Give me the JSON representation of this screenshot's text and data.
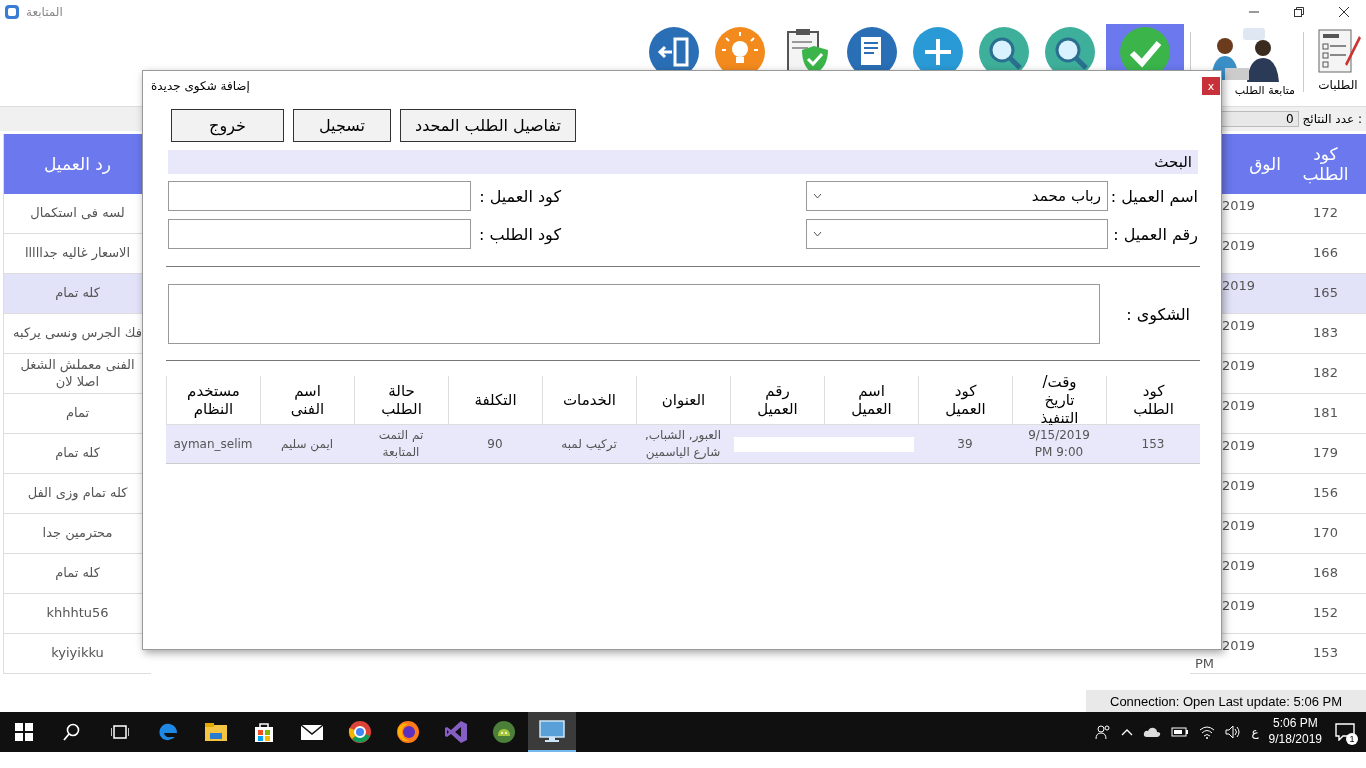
{
  "window": {
    "title": "المتابعة"
  },
  "toolbar": {
    "items": [
      {
        "kind": "orders",
        "label": "الطلبات",
        "selected": false
      },
      {
        "kind": "support",
        "label": "متابعة الطلب",
        "selected": false
      },
      {
        "kind": "check",
        "selected": true
      },
      {
        "kind": "search",
        "selected": false
      },
      {
        "kind": "search",
        "selected": false
      },
      {
        "kind": "add",
        "selected": false
      },
      {
        "kind": "document",
        "selected": false
      },
      {
        "kind": "clipboard",
        "selected": false
      },
      {
        "kind": "idea",
        "selected": false
      },
      {
        "kind": "exit",
        "selected": false
      }
    ]
  },
  "results": {
    "label": "عدد النتائج :",
    "value": "0"
  },
  "table": {
    "columns": [
      "كود الطلب",
      "الوق",
      "رد العميل"
    ],
    "rows": [
      {
        "code": "172",
        "time": "2019",
        "reply": "لسه فى استكمال",
        "selected": false
      },
      {
        "code": "166",
        "time": "2019",
        "reply": "الاسعار غاليه جدااااا",
        "selected": false
      },
      {
        "code": "165",
        "time": "2019",
        "reply": "كله تمام",
        "selected": true
      },
      {
        "code": "183",
        "time": "2019",
        "reply": "فك الجرس ونسى يركبه",
        "selected": false
      },
      {
        "code": "182",
        "time": "2019",
        "reply": "الفنى معملش الشغل اصلا لان",
        "selected": false
      },
      {
        "code": "181",
        "time": "2019",
        "reply": "تمام",
        "selected": false
      },
      {
        "code": "179",
        "time": "2019",
        "reply": "كله تمام",
        "selected": false
      },
      {
        "code": "156",
        "time": "2019",
        "reply": "كله تمام وزى الفل",
        "selected": false
      },
      {
        "code": "170",
        "time": "2019",
        "reply": "محترمين جدا",
        "selected": false
      },
      {
        "code": "168",
        "time": "2019",
        "reply": "كله تمام",
        "selected": false
      },
      {
        "code": "152",
        "time": "2019",
        "reply": "khhhtu56",
        "selected": false
      },
      {
        "code": "153",
        "time": "2019",
        "time_suffix": "PM",
        "reply": "kyiyikku",
        "selected": false
      }
    ]
  },
  "dialog": {
    "title": "إضافة شكوى جديدة",
    "close": "x",
    "buttons": [
      "تفاصيل الطلب المحدد",
      "تسجيل",
      "خروج"
    ],
    "section": "البحث",
    "customer_name": {
      "label": "اسم العميل :",
      "value": "رباب محمد"
    },
    "customer_code": {
      "label": "كود العميل :"
    },
    "customer_phone": {
      "label": "رقم العميل :"
    },
    "order_code": {
      "label": "كود الطلب :"
    },
    "complaint": {
      "label": "الشكوى :"
    },
    "orders": {
      "columns": [
        "كود الطلب",
        "وقت/تاريخ التنفيذ",
        "كود العميل",
        "اسم العميل",
        "رقم العميل",
        "العنوان",
        "الخدمات",
        "التكلفة",
        "حالة الطلب",
        "اسم الفنى",
        "مستخدم النظام"
      ],
      "rows": [
        {
          "selected": true,
          "order_code": "153",
          "exec_time": "9/15/2019 PM 9:00",
          "customer_code": "39",
          "address": "العبور, الشباب, شارع الياسمين",
          "services": "تركيب لمبه",
          "cost": "90",
          "status": "تم التمت المتابعة",
          "technician": "ايمن سليم",
          "user": "ayman_selim"
        }
      ]
    }
  },
  "status_bar": "Connection: Open Last update: 5:06 PM",
  "taskbar": {
    "apps": [
      {
        "kind": "start",
        "active": false
      },
      {
        "kind": "search",
        "active": false
      },
      {
        "kind": "taskview",
        "active": false
      },
      {
        "kind": "edge",
        "active": false
      },
      {
        "kind": "folder",
        "active": false
      },
      {
        "kind": "store",
        "active": false
      },
      {
        "kind": "mail",
        "active": false
      },
      {
        "kind": "chrome",
        "active": false
      },
      {
        "kind": "firefox",
        "active": false
      },
      {
        "kind": "vs",
        "active": false
      },
      {
        "kind": "android",
        "active": false
      },
      {
        "kind": "monitor",
        "active": true
      }
    ],
    "language": "ع",
    "time": "5:06 PM",
    "date": "9/18/2019",
    "notifications": "1"
  }
}
